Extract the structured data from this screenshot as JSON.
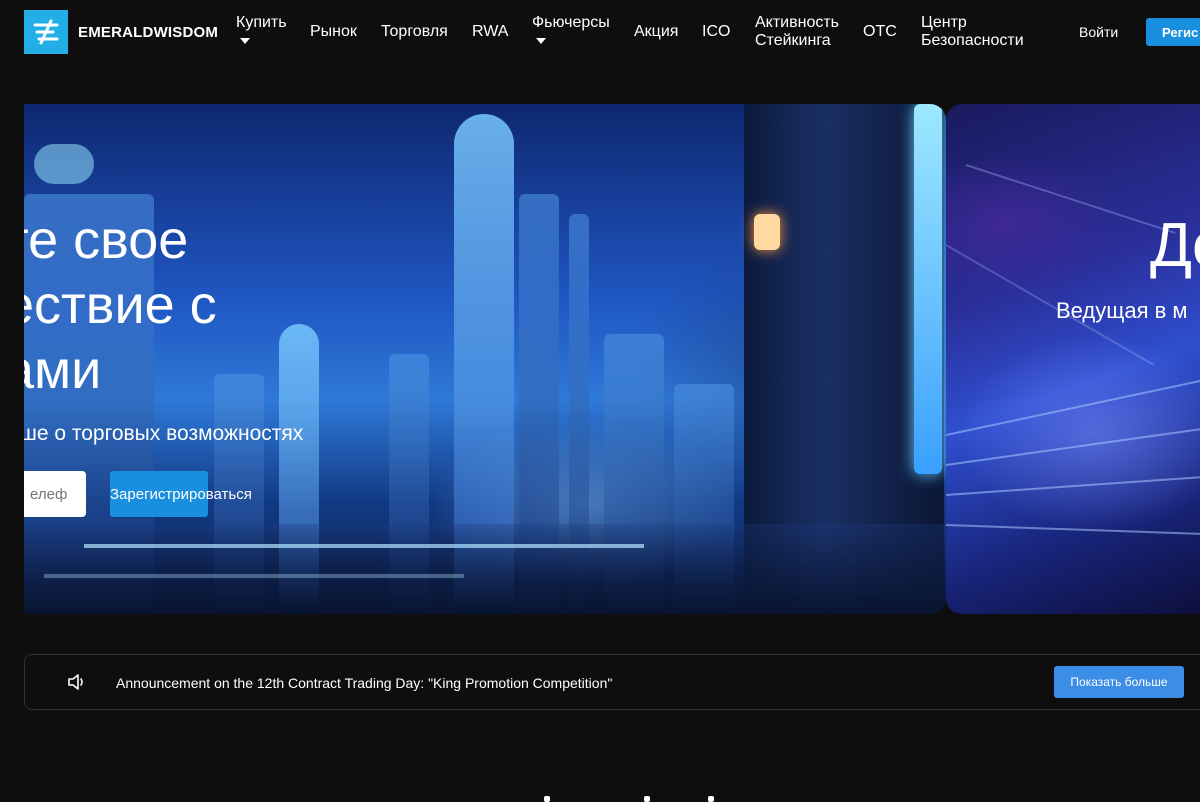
{
  "header": {
    "brand": "EMERALDWISDOM",
    "nav": [
      {
        "label": "Купить",
        "dropdown": true
      },
      {
        "label": "Рынок"
      },
      {
        "label": "Торговля"
      },
      {
        "label": "RWA"
      },
      {
        "label": "Фьючерсы",
        "dropdown": true
      },
      {
        "label": "Акция"
      },
      {
        "label": "ICO"
      },
      {
        "label": "Активность Стейкинга"
      },
      {
        "label": "OTC"
      },
      {
        "label": "Центр Безопасности"
      }
    ],
    "nav_two_line": {
      "staking_line1": "Активность",
      "staking_line2": "Стейкинга",
      "security_line1": "Центр",
      "security_line2": "Безопасности"
    },
    "login": "Войти",
    "register": "Регис"
  },
  "hero": {
    "slide1": {
      "title_line1": "те свое",
      "title_line2": "ествие с",
      "title_line3": "ами",
      "subtitle": "ше о торговых возможностях",
      "phone_placeholder": "елеф",
      "register_button": "Зарегистрироваться"
    },
    "slide2": {
      "title": "Дo",
      "subtitle": "Ведущая в м"
    }
  },
  "announcement": {
    "text": "Announcement on the 12th Contract Trading Day: \"King Promotion Competition\"",
    "more_button": "Показать больше"
  },
  "colors": {
    "background": "#0e0e0f",
    "accent": "#1a8fe0",
    "logo": "#22aee6",
    "more_button": "#3b8de6"
  }
}
